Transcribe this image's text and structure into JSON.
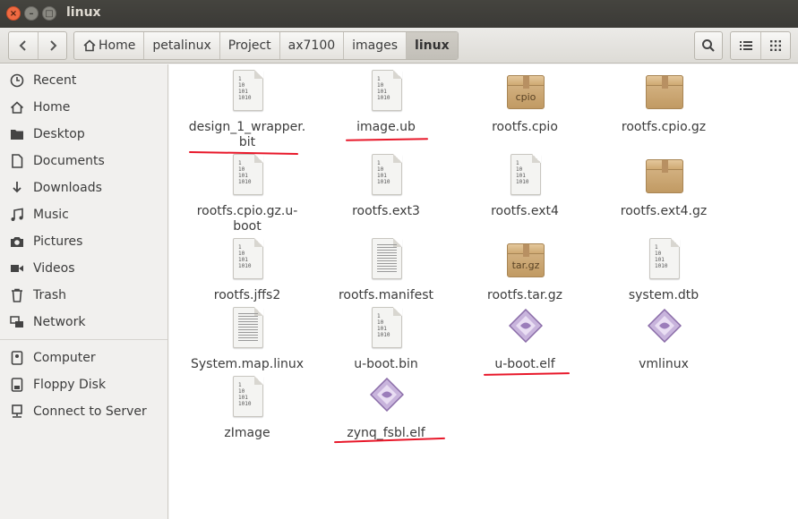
{
  "window": {
    "title": "linux",
    "controls": {
      "close": "×",
      "minimize": "–",
      "maximize": "□"
    }
  },
  "toolbar": {
    "back_icon": "chevron-left-icon",
    "forward_icon": "chevron-right-icon",
    "breadcrumbs": [
      "Home",
      "petalinux",
      "Project",
      "ax7100",
      "images",
      "linux"
    ],
    "active_crumb": "linux",
    "search_icon": "search-icon",
    "list_view_icon": "list-view-icon",
    "grid_view_icon": "grid-view-icon"
  },
  "sidebar": {
    "items": [
      {
        "label": "Recent",
        "icon": "clock-icon"
      },
      {
        "label": "Home",
        "icon": "home-icon"
      },
      {
        "label": "Desktop",
        "icon": "desktop-folder-icon"
      },
      {
        "label": "Documents",
        "icon": "document-icon"
      },
      {
        "label": "Downloads",
        "icon": "download-icon"
      },
      {
        "label": "Music",
        "icon": "music-icon"
      },
      {
        "label": "Pictures",
        "icon": "camera-icon"
      },
      {
        "label": "Videos",
        "icon": "video-icon"
      },
      {
        "label": "Trash",
        "icon": "trash-icon"
      },
      {
        "label": "Network",
        "icon": "network-icon"
      },
      {
        "label": "Computer",
        "icon": "computer-icon"
      },
      {
        "label": "Floppy Disk",
        "icon": "floppy-icon"
      },
      {
        "label": "Connect to Server",
        "icon": "server-icon"
      }
    ]
  },
  "files": [
    {
      "name": "design_1_wrapper.\nbit",
      "type": "binary",
      "underlined": true
    },
    {
      "name": "image.ub",
      "type": "binary",
      "underlined": true
    },
    {
      "name": "rootfs.cpio",
      "type": "archive",
      "badge": "cpio",
      "underlined": false
    },
    {
      "name": "rootfs.cpio.gz",
      "type": "archive",
      "badge": "",
      "underlined": false
    },
    {
      "name": "rootfs.cpio.gz.u-\nboot",
      "type": "binary",
      "underlined": false
    },
    {
      "name": "rootfs.ext3",
      "type": "binary",
      "underlined": false
    },
    {
      "name": "rootfs.ext4",
      "type": "binary",
      "underlined": false
    },
    {
      "name": "rootfs.ext4.gz",
      "type": "archive",
      "badge": "",
      "underlined": false
    },
    {
      "name": "rootfs.jffs2",
      "type": "binary",
      "underlined": false
    },
    {
      "name": "rootfs.manifest",
      "type": "text",
      "underlined": false
    },
    {
      "name": "rootfs.tar.gz",
      "type": "archive",
      "badge": "tar.gz",
      "underlined": false
    },
    {
      "name": "system.dtb",
      "type": "binary",
      "underlined": false
    },
    {
      "name": "System.map.linux",
      "type": "text",
      "underlined": false
    },
    {
      "name": "u-boot.bin",
      "type": "binary",
      "underlined": false
    },
    {
      "name": "u-boot.elf",
      "type": "executable",
      "underlined": true
    },
    {
      "name": "vmlinux",
      "type": "executable",
      "underlined": false
    },
    {
      "name": "zImage",
      "type": "binary",
      "underlined": false
    },
    {
      "name": "zynq_fsbl.elf",
      "type": "executable",
      "underlined": true
    }
  ],
  "binary_glyph": "1\n10\n101\n1010",
  "colors": {
    "annotation_red": "#e8182a",
    "close_button": "#ef6a42",
    "titlebar": "#3c3b37"
  }
}
